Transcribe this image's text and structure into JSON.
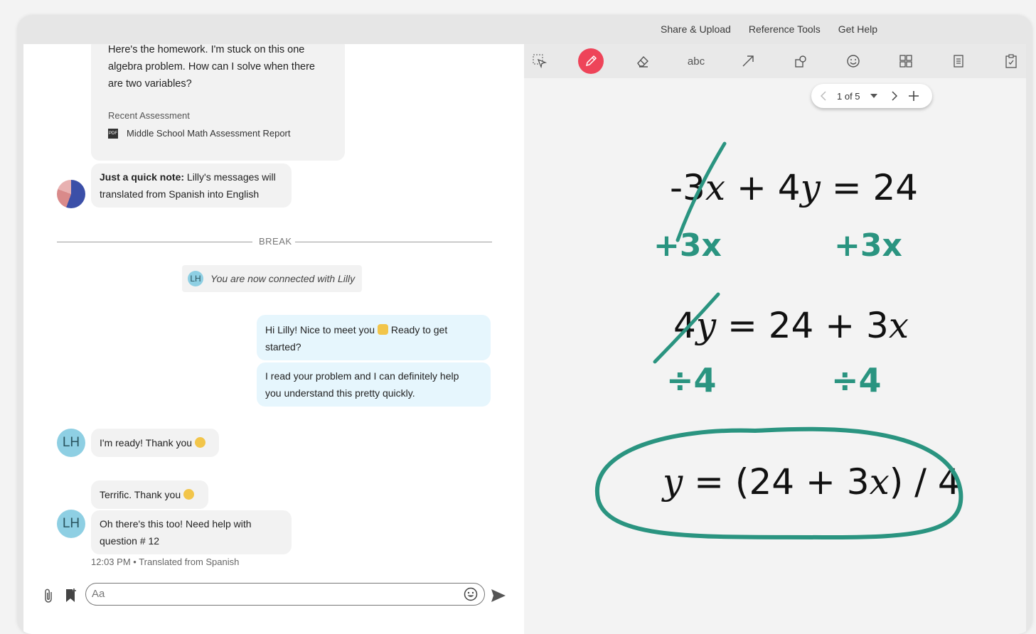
{
  "menu": [
    "Share & Upload",
    "Reference Tools",
    "Get Help"
  ],
  "chat": {
    "first_message": [
      "Here's the homework. I'm stuck on this one",
      "algebra problem. How can I solve when there",
      "are two variables?"
    ],
    "recent_assessment_label": "Recent Assessment",
    "report_name": "Middle School Math Assessment Report",
    "note_bold": "Just a quick note:",
    "note_line1": " Lilly's messages will",
    "note_line2": "translated from Spanish into English",
    "break_label": "BREAK",
    "connected_text": "You are now connected with Lilly",
    "avatar_initials": "LH",
    "tutor_msg1_line1": "Hi Lilly! Nice to meet you",
    "tutor_msg1_line1b": "Ready to get",
    "tutor_msg1_line2": "started?",
    "tutor_msg2_line1": "I read your problem and I can definitely help",
    "tutor_msg2_line2": "you understand this pretty quickly.",
    "student_ready": "I'm ready! Thank you",
    "terrific": "Terrific. Thank you",
    "question_line1": "Oh there's this too! Need help with",
    "question_line2": "question # 12",
    "meta_time": "12:03 PM",
    "meta_translated": "Translated from Spanish",
    "input_placeholder": "Aa"
  },
  "board": {
    "tools": [
      "select-tool-icon",
      "pencil-icon",
      "eraser-icon",
      "text-tool",
      "arrow-icon",
      "shapes-icon",
      "emoji-icon",
      "layout-icon",
      "notes-icon",
      "clipboard-icon"
    ],
    "text_tool_label": "abc",
    "page_indicator": "1 of 5",
    "eq1_left": "-3",
    "eq1_mid": " + 4",
    "eq1_right": " = 24",
    "annot_plus3x": "+3x",
    "eq2_left": "4",
    "eq2_right": " = 24 + 3",
    "annot_div4": "÷4",
    "eq3_a": " = (24 + 3",
    "eq3_b": ") / 4",
    "var_x": "x",
    "var_y": "y"
  },
  "colors": {
    "pen": "#2a9480",
    "active_tool": "#ee4459",
    "tutor_bubble": "#e6f6fd",
    "avatar": "#8ecfe3"
  }
}
